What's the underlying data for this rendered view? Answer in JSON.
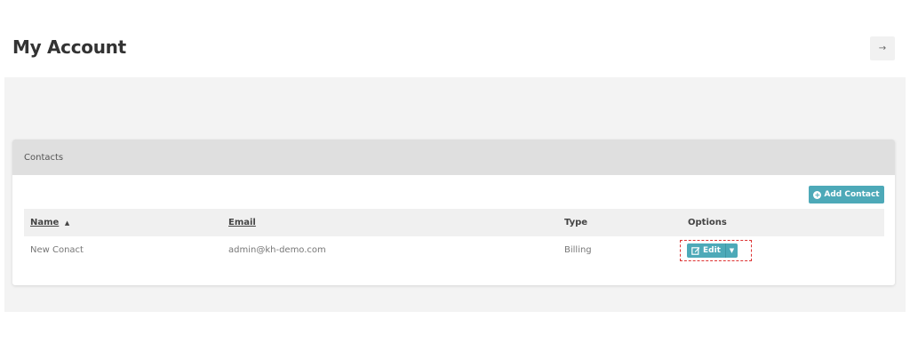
{
  "header": {
    "title": "My Account",
    "logout_glyph": "→"
  },
  "contacts": {
    "card_title": "Contacts",
    "add_button_label": "Add Contact",
    "add_icon": "plus-circle-icon",
    "columns": {
      "name": "Name",
      "name_sort_indicator": "▲",
      "email": "Email",
      "type": "Type",
      "options": "Options"
    },
    "rows": [
      {
        "name": "New Conact",
        "email": "admin@kh-demo.com",
        "type": "Billing",
        "edit_label": "Edit",
        "edit_icon": "edit-icon",
        "caret_glyph": "▼"
      }
    ]
  },
  "colors": {
    "accent": "#4da9b8",
    "highlight_outline": "#dd3333"
  }
}
